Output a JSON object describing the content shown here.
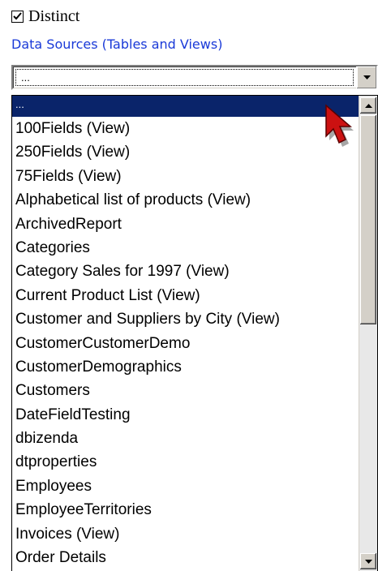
{
  "distinct": {
    "label": "Distinct",
    "checked": true
  },
  "data_sources": {
    "title": "Data Sources (Tables and Views)",
    "selected_value": "...",
    "items": [
      "...",
      "100Fields (View)",
      "250Fields (View)",
      "75Fields (View)",
      "Alphabetical list of products (View)",
      "ArchivedReport",
      "Categories",
      "Category Sales for 1997 (View)",
      "Current Product List (View)",
      "Customer and Suppliers by City (View)",
      "CustomerCustomerDemo",
      "CustomerDemographics",
      "Customers",
      "DateFieldTesting",
      "dbizenda",
      "dtproperties",
      "Employees",
      "EmployeeTerritories",
      "Invoices (View)",
      "Order Details"
    ]
  },
  "icons": {
    "check": "check-icon",
    "dropdown_arrow": "chevron-down-icon",
    "scroll_up": "scroll-up-arrow-icon",
    "scroll_down": "scroll-down-arrow-icon",
    "cursor": "mouse-pointer-icon"
  },
  "colors": {
    "heading": "#1a3ad8",
    "selection": "#0a246a",
    "cursor": "#cc1111"
  }
}
